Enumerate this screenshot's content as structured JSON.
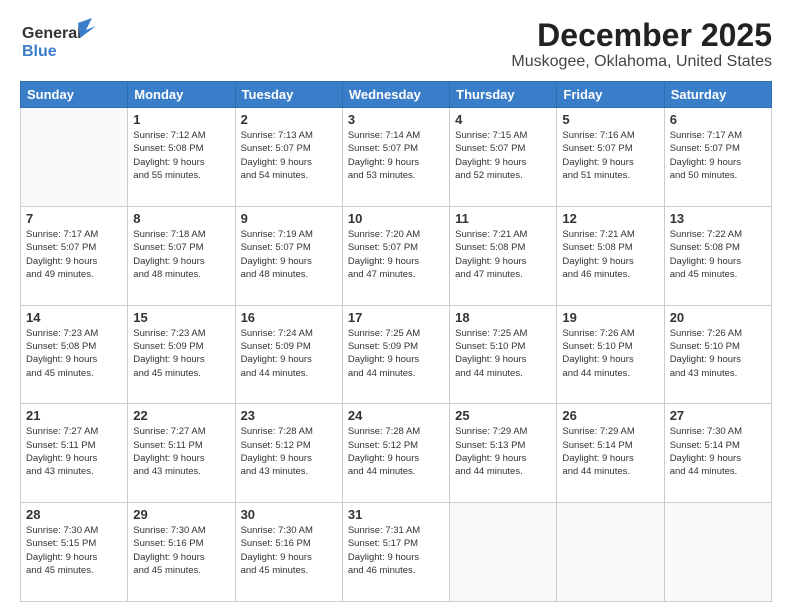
{
  "header": {
    "logo_general": "General",
    "logo_blue": "Blue",
    "main_title": "December 2025",
    "subtitle": "Muskogee, Oklahoma, United States"
  },
  "calendar": {
    "days_of_week": [
      "Sunday",
      "Monday",
      "Tuesday",
      "Wednesday",
      "Thursday",
      "Friday",
      "Saturday"
    ],
    "weeks": [
      [
        {
          "day": "",
          "info": ""
        },
        {
          "day": "1",
          "info": "Sunrise: 7:12 AM\nSunset: 5:08 PM\nDaylight: 9 hours\nand 55 minutes."
        },
        {
          "day": "2",
          "info": "Sunrise: 7:13 AM\nSunset: 5:07 PM\nDaylight: 9 hours\nand 54 minutes."
        },
        {
          "day": "3",
          "info": "Sunrise: 7:14 AM\nSunset: 5:07 PM\nDaylight: 9 hours\nand 53 minutes."
        },
        {
          "day": "4",
          "info": "Sunrise: 7:15 AM\nSunset: 5:07 PM\nDaylight: 9 hours\nand 52 minutes."
        },
        {
          "day": "5",
          "info": "Sunrise: 7:16 AM\nSunset: 5:07 PM\nDaylight: 9 hours\nand 51 minutes."
        },
        {
          "day": "6",
          "info": "Sunrise: 7:17 AM\nSunset: 5:07 PM\nDaylight: 9 hours\nand 50 minutes."
        }
      ],
      [
        {
          "day": "7",
          "info": "Sunrise: 7:17 AM\nSunset: 5:07 PM\nDaylight: 9 hours\nand 49 minutes."
        },
        {
          "day": "8",
          "info": "Sunrise: 7:18 AM\nSunset: 5:07 PM\nDaylight: 9 hours\nand 48 minutes."
        },
        {
          "day": "9",
          "info": "Sunrise: 7:19 AM\nSunset: 5:07 PM\nDaylight: 9 hours\nand 48 minutes."
        },
        {
          "day": "10",
          "info": "Sunrise: 7:20 AM\nSunset: 5:07 PM\nDaylight: 9 hours\nand 47 minutes."
        },
        {
          "day": "11",
          "info": "Sunrise: 7:21 AM\nSunset: 5:08 PM\nDaylight: 9 hours\nand 47 minutes."
        },
        {
          "day": "12",
          "info": "Sunrise: 7:21 AM\nSunset: 5:08 PM\nDaylight: 9 hours\nand 46 minutes."
        },
        {
          "day": "13",
          "info": "Sunrise: 7:22 AM\nSunset: 5:08 PM\nDaylight: 9 hours\nand 45 minutes."
        }
      ],
      [
        {
          "day": "14",
          "info": "Sunrise: 7:23 AM\nSunset: 5:08 PM\nDaylight: 9 hours\nand 45 minutes."
        },
        {
          "day": "15",
          "info": "Sunrise: 7:23 AM\nSunset: 5:09 PM\nDaylight: 9 hours\nand 45 minutes."
        },
        {
          "day": "16",
          "info": "Sunrise: 7:24 AM\nSunset: 5:09 PM\nDaylight: 9 hours\nand 44 minutes."
        },
        {
          "day": "17",
          "info": "Sunrise: 7:25 AM\nSunset: 5:09 PM\nDaylight: 9 hours\nand 44 minutes."
        },
        {
          "day": "18",
          "info": "Sunrise: 7:25 AM\nSunset: 5:10 PM\nDaylight: 9 hours\nand 44 minutes."
        },
        {
          "day": "19",
          "info": "Sunrise: 7:26 AM\nSunset: 5:10 PM\nDaylight: 9 hours\nand 44 minutes."
        },
        {
          "day": "20",
          "info": "Sunrise: 7:26 AM\nSunset: 5:10 PM\nDaylight: 9 hours\nand 43 minutes."
        }
      ],
      [
        {
          "day": "21",
          "info": "Sunrise: 7:27 AM\nSunset: 5:11 PM\nDaylight: 9 hours\nand 43 minutes."
        },
        {
          "day": "22",
          "info": "Sunrise: 7:27 AM\nSunset: 5:11 PM\nDaylight: 9 hours\nand 43 minutes."
        },
        {
          "day": "23",
          "info": "Sunrise: 7:28 AM\nSunset: 5:12 PM\nDaylight: 9 hours\nand 43 minutes."
        },
        {
          "day": "24",
          "info": "Sunrise: 7:28 AM\nSunset: 5:12 PM\nDaylight: 9 hours\nand 44 minutes."
        },
        {
          "day": "25",
          "info": "Sunrise: 7:29 AM\nSunset: 5:13 PM\nDaylight: 9 hours\nand 44 minutes."
        },
        {
          "day": "26",
          "info": "Sunrise: 7:29 AM\nSunset: 5:14 PM\nDaylight: 9 hours\nand 44 minutes."
        },
        {
          "day": "27",
          "info": "Sunrise: 7:30 AM\nSunset: 5:14 PM\nDaylight: 9 hours\nand 44 minutes."
        }
      ],
      [
        {
          "day": "28",
          "info": "Sunrise: 7:30 AM\nSunset: 5:15 PM\nDaylight: 9 hours\nand 45 minutes."
        },
        {
          "day": "29",
          "info": "Sunrise: 7:30 AM\nSunset: 5:16 PM\nDaylight: 9 hours\nand 45 minutes."
        },
        {
          "day": "30",
          "info": "Sunrise: 7:30 AM\nSunset: 5:16 PM\nDaylight: 9 hours\nand 45 minutes."
        },
        {
          "day": "31",
          "info": "Sunrise: 7:31 AM\nSunset: 5:17 PM\nDaylight: 9 hours\nand 46 minutes."
        },
        {
          "day": "",
          "info": ""
        },
        {
          "day": "",
          "info": ""
        },
        {
          "day": "",
          "info": ""
        }
      ]
    ]
  }
}
